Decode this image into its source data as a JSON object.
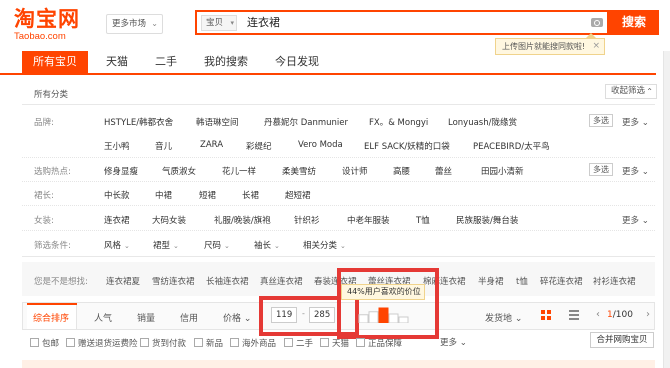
{
  "header": {
    "logo_cn": "淘宝网",
    "logo_en": "Taobao.com",
    "market_label": "更多市场",
    "search_type": "宝贝",
    "search_query": "连衣裙",
    "search_button": "搜索",
    "image_search_tip": "上传图片就能搜同款啦!",
    "tip_close": "×"
  },
  "tabs": [
    "所有宝贝",
    "天猫",
    "二手",
    "我的搜索",
    "今日发现"
  ],
  "all_categories": "所有分类",
  "collapse_filter": "收起筛选",
  "filters": {
    "brand_label": "品牌:",
    "brands_row1": [
      "HSTYLE/韩都衣舍",
      "韩语琳空间",
      "丹慕妮尔 Danmunier",
      "FX。& Mongyi",
      "Lonyuash/陇缘赏"
    ],
    "brands_row2": [
      "王小鸭",
      "音儿",
      "ZARA",
      "彩缇纪",
      "Vero Moda",
      "ELF SACK/妖精的口袋",
      "PEACEBIRD/太平鸟"
    ],
    "multi_label": "多选",
    "more_label": "更多",
    "hot_label": "选购热点:",
    "hot_items": [
      "修身显瘦",
      "气质淑女",
      "花儿一样",
      "柔美雪纺",
      "设计师",
      "高腰",
      "蕾丝",
      "田园小清新"
    ],
    "length_label": "裙长:",
    "length_items": [
      "中长款",
      "中裙",
      "短裙",
      "长裙",
      "超短裙"
    ],
    "women_label": "女装:",
    "women_items": [
      "连衣裙",
      "大码女装",
      "礼服/晚装/旗袍",
      "针织衫",
      "中老年服装",
      "T恤",
      "民族服装/舞台装"
    ],
    "cond_label": "筛选条件:",
    "cond_items": [
      "风格",
      "裙型",
      "尺码",
      "袖长",
      "相关分类"
    ]
  },
  "guess": {
    "label": "您是不是想找:",
    "items": [
      "连衣裙夏",
      "雪纺连衣裙",
      "长袖连衣裙",
      "真丝连衣裙",
      "春装连衣裙",
      "蕾丝连衣裙",
      "棉麻连衣裙",
      "半身裙",
      "t恤",
      "碎花连衣裙",
      "衬衫连衣裙"
    ]
  },
  "sortbar": {
    "items": [
      "综合排序",
      "人气",
      "销量",
      "信用",
      "价格"
    ],
    "price_min": "119",
    "price_max": "285",
    "price_tip": "44%用户喜欢的价位",
    "ship_from": "发货地",
    "page_current": "1",
    "page_total": "/100"
  },
  "checkboxes": [
    "包邮",
    "赠送退货运费险",
    "货到付款",
    "新品",
    "海外商品",
    "二手",
    "天猫",
    "正品保障"
  ],
  "more_label2": "更多",
  "merge_label": "合并网购宝贝",
  "colors": {
    "accent": "#ff4400",
    "highlight": "#e53935"
  },
  "price_distribution": [
    0.55,
    0.75,
    1.0,
    0.6,
    0.4
  ]
}
